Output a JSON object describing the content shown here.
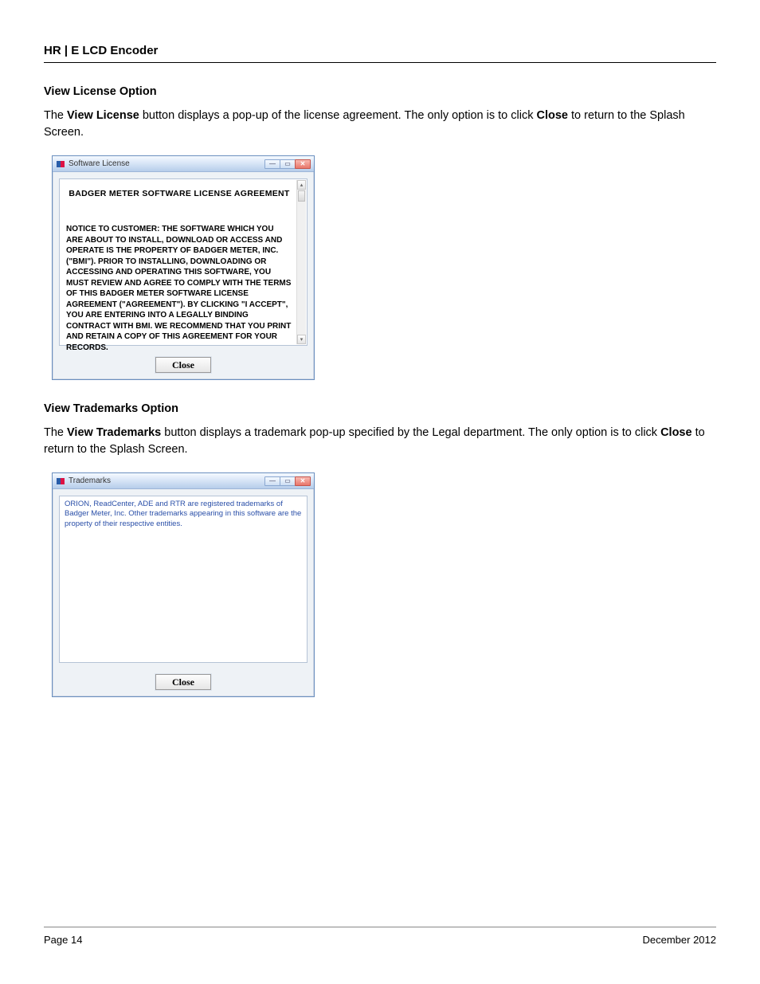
{
  "header": {
    "title": "HR | E LCD Encoder"
  },
  "section1": {
    "heading": "View License Option",
    "para_pre": "The ",
    "para_bold1": "View License",
    "para_mid": " button displays a pop-up of the license agreement. The only option is to click ",
    "para_bold2": "Close",
    "para_post": " to return to the Splash Screen."
  },
  "dialog1": {
    "title": "Software License",
    "content_title": "BADGER METER SOFTWARE LICENSE AGREEMENT",
    "notice": "NOTICE TO CUSTOMER:   THE SOFTWARE WHICH YOU ARE ABOUT TO INSTALL, DOWNLOAD OR ACCESS AND OPERATE IS THE PROPERTY OF BADGER METER, INC. (\"BMI\").   PRIOR TO INSTALLING, DOWNLOADING OR ACCESSING AND OPERATING THIS SOFTWARE, YOU MUST REVIEW AND AGREE TO COMPLY WITH THE TERMS OF THIS BADGER METER SOFTWARE LICENSE AGREEMENT (\"AGREEMENT\").  BY CLICKING \"I ACCEPT\", YOU ARE ENTERING INTO A LEGALLY BINDING CONTRACT WITH BMI.  WE RECOMMEND THAT YOU PRINT AND RETAIN A COPY OF THIS AGREEMENT FOR YOUR RECORDS.",
    "close": "Close"
  },
  "section2": {
    "heading": "View Trademarks Option",
    "para_pre": "The ",
    "para_bold1": "View Trademarks",
    "para_mid": " button displays a trademark pop-up specified by the Legal department. The only option is to click ",
    "para_bold2": "Close",
    "para_post": " to return to the Splash Screen."
  },
  "dialog2": {
    "title": "Trademarks",
    "content": "ORION, ReadCenter, ADE and RTR are registered trademarks of Badger Meter, Inc. Other trademarks appearing in this software are the property of their respective entities.",
    "close": "Close"
  },
  "footer": {
    "page": "Page 14",
    "date": "December 2012"
  }
}
